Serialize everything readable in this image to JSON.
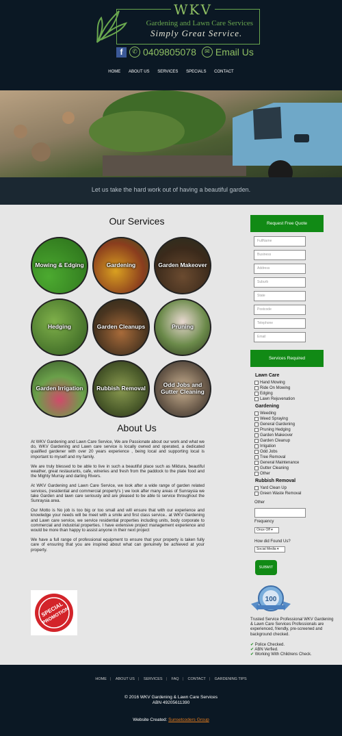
{
  "header": {
    "brand": "WKV",
    "subtitle": "Gardening and Lawn Care Services",
    "tagline": "Simply Great Service.",
    "phone": "0409805078",
    "email_label": "Email Us",
    "nav": [
      "HOME",
      "ABOUT US",
      "SERVICES",
      "SPECIALS",
      "CONTACT"
    ]
  },
  "hero": {
    "tagline": "Let us take the hard work out of having a beautiful garden."
  },
  "services": {
    "title": "Our Services",
    "items": [
      "Mowing & Edging",
      "Gardening",
      "Garden Makeover",
      "Hedging",
      "Garden Cleanups",
      "Pruning",
      "Garden Irrigation",
      "Rubbish Removal",
      "Odd Jobs and Gutter Cleaning"
    ]
  },
  "about": {
    "title": "About Us",
    "paragraphs": [
      "At WKV Gardening and Lawn Care Service, We are Passionate about our work and what we do, WKV Gardening and Lawn care service is locally owned and operated, a dedicated qualified gardener with over 20 years experience , being local and supporting local is important to myself and my family.",
      "We are truly blessed to be able to live in such a beautiful place such as Mildura, beautiful weather, great restaurants, cafe, wineries and fresh from the paddock to the plate food and the Mighty Murray and darling Rivers.",
      "At WKV Gardening and Lawn Care Service, we look after a wide range of garden related services, (residential and commercial property's ) we look after many areas of Sunraysia we take Garden and lawn care seriously and are pleased to be able to service throughout the Sunraysia area.",
      "Our Motto is No job is too big or too small and will ensure that with our experience and knowledge your needs will be meet with a smile and first class service.. at WKV Gardening and Lawn care service, we service residential properties including units, body corporate to commercial and industrial properties. I have extensive project management experience and would be more than happy to assist anyone in their next project",
      "We have a full range of professional equipment to ensure that your property is taken fully care of ensuring that you are inspired about what can genuinely be achieved at your property."
    ]
  },
  "promo": {
    "line1": "SPECIAL",
    "line2": "PROMOTION"
  },
  "quote_form": {
    "title": "Request Free Quote",
    "fields": [
      "FullName",
      "Business",
      "Address",
      "Suburb",
      "State",
      "Postcode",
      "Telephone",
      "Email"
    ],
    "services_title": "Services Required",
    "groups": [
      {
        "name": "Lawn Care",
        "items": [
          "Hand Mowing",
          "Ride On Mowing",
          "Edging",
          "Lawn Rejuvenation"
        ]
      },
      {
        "name": "Gardening",
        "items": [
          "Weeding",
          "Weed Spraying",
          "General Gardening",
          "Pruning Hedging",
          "Garden Makeover",
          "Garden Cleanup",
          "Irrigation",
          "Odd Jobs",
          "Tree Removal",
          "General Maintenance",
          "Gutter Cleaning",
          "Other"
        ]
      },
      {
        "name": "Rubbish Removal",
        "items": [
          "Yard Clean Up",
          "Green Waste Removal"
        ]
      }
    ],
    "other_label": "Other",
    "frequency_label": "Frequency",
    "frequency_value": "Once Off",
    "found_label": "How did Found Us?",
    "found_value": "Social Media",
    "submit": "SUBMIT"
  },
  "trust": {
    "badge": "100",
    "text": "Trusted Service Professional WKV Gardening & Lawn Care Services Professionals are experienced, friendly, pre-screened and background checked.",
    "checks": [
      "Police Checked.",
      "ABN Verfied.",
      "Working With Childrens Check."
    ]
  },
  "footer": {
    "nav": [
      "HOME",
      "ABOUT US",
      "SERVICES",
      "FAQ",
      "CONTACT",
      "GARDENING TIPS"
    ],
    "copyright": "© 2016 WKV Gardening & Lawn Care Services",
    "abn": "ABN 49205611390",
    "credit_label": "Website Created:",
    "credit_link": "Sunsetcoders Group"
  }
}
